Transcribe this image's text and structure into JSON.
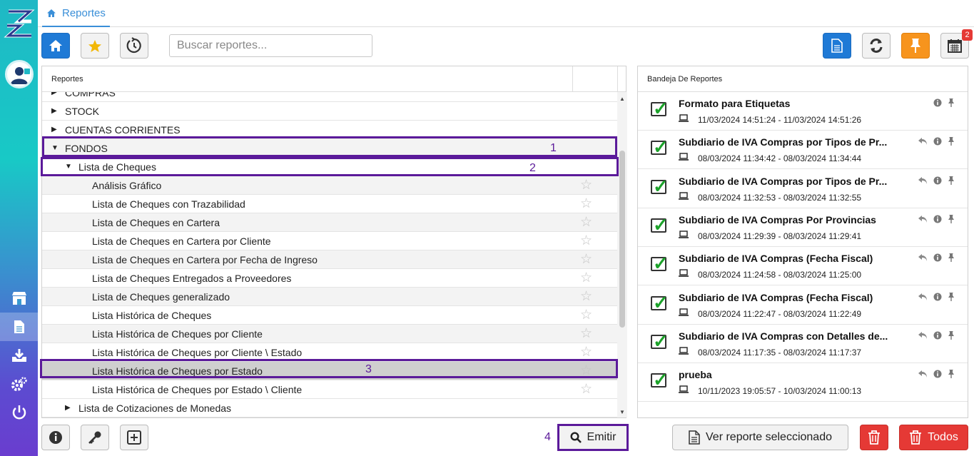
{
  "header": {
    "tab_label": "Reportes"
  },
  "toolbar": {
    "search_placeholder": "Buscar reportes...",
    "notification_count": "2"
  },
  "left_panel": {
    "header": "Reportes",
    "rows": [
      {
        "label": "COMPRAS",
        "level": 0,
        "expanded": false
      },
      {
        "label": "STOCK",
        "level": 0,
        "expanded": false
      },
      {
        "label": "CUENTAS CORRIENTES",
        "level": 0,
        "expanded": false
      },
      {
        "label": "FONDOS",
        "level": 0,
        "expanded": true
      },
      {
        "label": "Lista de Cheques",
        "level": 1,
        "expanded": true
      },
      {
        "label": "Análisis Gráfico",
        "level": 2
      },
      {
        "label": "Lista de Cheques con Trazabilidad",
        "level": 2
      },
      {
        "label": "Lista de Cheques en Cartera",
        "level": 2
      },
      {
        "label": "Lista de Cheques en Cartera por Cliente",
        "level": 2
      },
      {
        "label": "Lista de Cheques en Cartera por Fecha de Ingreso",
        "level": 2
      },
      {
        "label": "Lista de Cheques Entregados a Proveedores",
        "level": 2
      },
      {
        "label": "Lista de Cheques generalizado",
        "level": 2
      },
      {
        "label": "Lista Histórica de Cheques",
        "level": 2
      },
      {
        "label": "Lista Histórica de Cheques por Cliente",
        "level": 2
      },
      {
        "label": "Lista Histórica de Cheques por Cliente \\ Estado",
        "level": 2
      },
      {
        "label": "Lista Histórica de Cheques por Estado",
        "level": 2,
        "selected": true
      },
      {
        "label": "Lista Histórica de Cheques por Estado \\ Cliente",
        "level": 2
      },
      {
        "label": "Lista de Cotizaciones de Monedas",
        "level": 1,
        "expanded": false
      }
    ]
  },
  "annotations": {
    "one": "1",
    "two": "2",
    "three": "3",
    "four": "4"
  },
  "right_panel": {
    "header": "Bandeja De Reportes",
    "items": [
      {
        "title": "Formato para Etiquetas",
        "time": "11/03/2024 14:51:24 - 11/03/2024 14:51:26"
      },
      {
        "title": "Subdiario de IVA Compras por Tipos de Pr...",
        "time": "08/03/2024 11:34:42 - 08/03/2024 11:34:44"
      },
      {
        "title": "Subdiario de IVA Compras por Tipos de Pr...",
        "time": "08/03/2024 11:32:53 - 08/03/2024 11:32:55"
      },
      {
        "title": "Subdiario de IVA Compras Por Provincias",
        "time": "08/03/2024 11:29:39 - 08/03/2024 11:29:41"
      },
      {
        "title": "Subdiario de IVA Compras (Fecha Fiscal)",
        "time": "08/03/2024 11:24:58 - 08/03/2024 11:25:00"
      },
      {
        "title": "Subdiario de IVA Compras (Fecha Fiscal)",
        "time": "08/03/2024 11:22:47 - 08/03/2024 11:22:49"
      },
      {
        "title": "Subdiario de IVA Compras con Detalles de...",
        "time": "08/03/2024 11:17:35 - 08/03/2024 11:17:37"
      },
      {
        "title": "prueba",
        "time": "10/11/2023 19:05:57 - 10/03/2024 11:00:13"
      }
    ]
  },
  "footer": {
    "emitir_label": "Emitir",
    "ver_reporte_label": "Ver reporte seleccionado",
    "todos_label": "Todos"
  },
  "colors": {
    "accent": "#1f7ad6",
    "highlight": "#5b1a9a",
    "danger": "#e53935",
    "check": "#1ca22a"
  }
}
